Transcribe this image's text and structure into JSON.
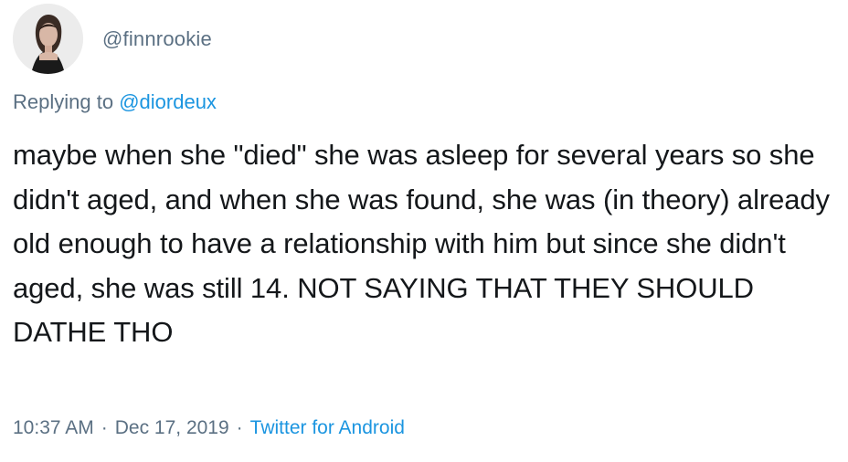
{
  "tweet": {
    "handle": "@finnrookie",
    "replying_prefix": "Replying to",
    "replying_to": "@diordeux",
    "text": "maybe when she \"died\" she was asleep for several years so she didn't aged, and when she was found, she was (in theory) already old enough to have a relationship with him but since she didn't aged, she was still 14. NOT SAYING THAT THEY SHOULD DATHE THO",
    "time": "10:37 AM",
    "separator": "·",
    "date": "Dec 17, 2019",
    "source": "Twitter for Android"
  },
  "colors": {
    "text": "#14171a",
    "secondary": "#5b7083",
    "link": "#1b95e0"
  }
}
